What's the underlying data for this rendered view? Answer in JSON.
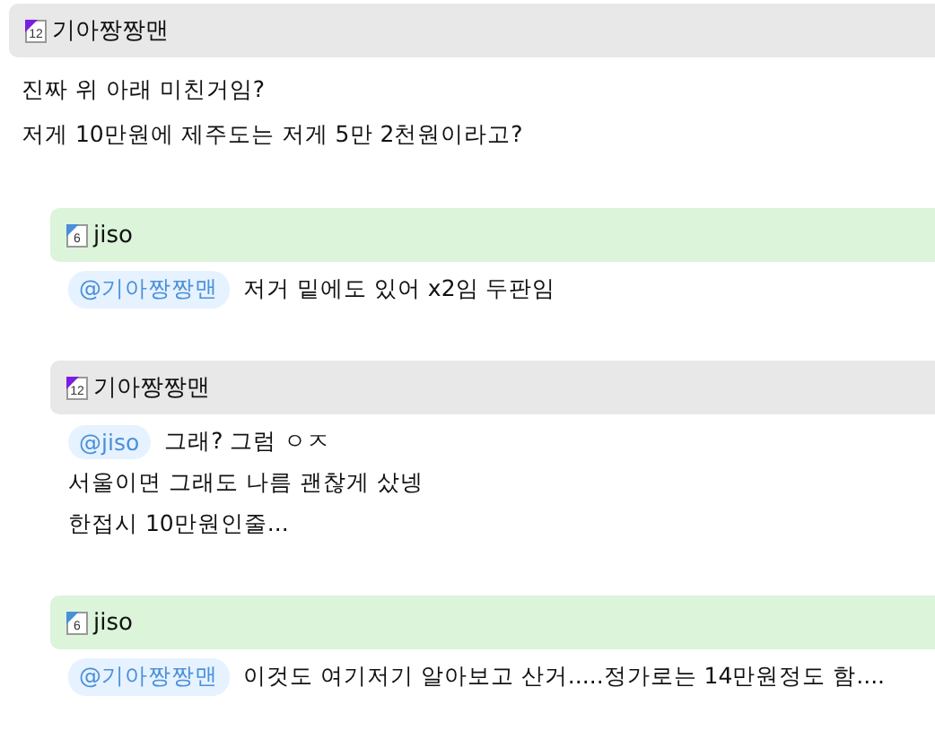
{
  "posts": [
    {
      "kind": "root",
      "user": "기아짱짱맨",
      "level": "12",
      "color": "#7a1fe0",
      "original_poster": true,
      "lines": [
        "진짜 위 아래 미친거임?",
        "저게 10만원에 제주도는 저게 5만 2천원이라고?"
      ]
    },
    {
      "kind": "reply",
      "user": "jiso",
      "level": "6",
      "color": "#4a90d9",
      "original_poster": false,
      "mention": "@기아짱짱맨",
      "lines": [
        "저거 밑에도 있어 x2임 두판임"
      ]
    },
    {
      "kind": "reply",
      "user": "기아짱짱맨",
      "level": "12",
      "color": "#7a1fe0",
      "original_poster": true,
      "mention": "@jiso",
      "lines": [
        "그래? 그럼 ㅇㅈ",
        "서울이면 그래도 나름 괜찮게 샀넹",
        "한접시 10만원인줄..."
      ]
    },
    {
      "kind": "reply",
      "user": "jiso",
      "level": "6",
      "color": "#4a90d9",
      "original_poster": false,
      "mention": "@기아짱짱맨",
      "lines": [
        "이것도 여기저기 알아보고 산거.....정가로는 14만원정도 함...."
      ]
    }
  ]
}
